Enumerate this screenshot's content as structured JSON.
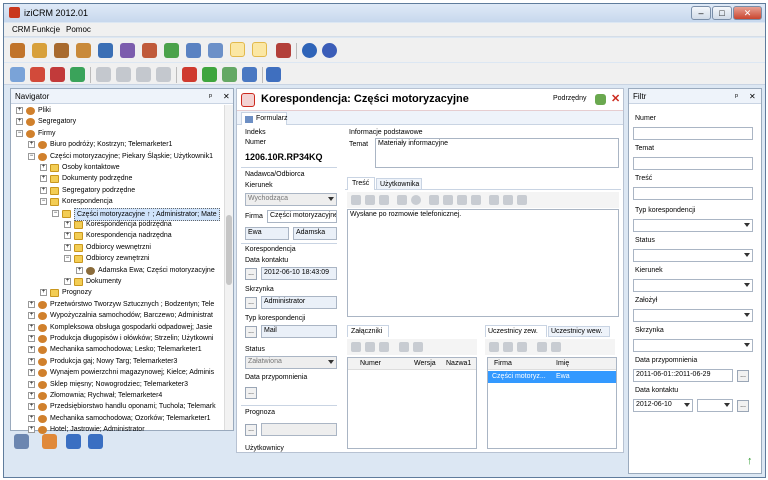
{
  "app": {
    "title": "iziCRM 2012.01"
  },
  "window": {
    "min": "–",
    "max": "□",
    "close": "✕"
  },
  "menu": [
    "CRM",
    "Funkcje",
    "Pomoc"
  ],
  "navigator": {
    "title": "Navigator",
    "pin": "ᵖ",
    "close": "✕",
    "nodes": [
      {
        "label": "Pliki",
        "depth": 0,
        "exp": "+",
        "icon": "gear"
      },
      {
        "label": "Segregatory",
        "depth": 0,
        "exp": "+",
        "icon": "gear"
      },
      {
        "label": "Firmy",
        "depth": 0,
        "exp": "−",
        "icon": "gear"
      },
      {
        "label": "Biuro podróży; Kostrzyn; Telemarketer1",
        "depth": 1,
        "exp": "+",
        "icon": "gear"
      },
      {
        "label": "Części motoryzacyjne; Piekary Śląskie; Użytkownik1",
        "depth": 1,
        "exp": "−",
        "icon": "gear"
      },
      {
        "label": "Osoby kontaktowe",
        "depth": 2,
        "exp": "+",
        "icon": "folder"
      },
      {
        "label": "Dokumenty podrzędne",
        "depth": 2,
        "exp": "+",
        "icon": "folder"
      },
      {
        "label": "Segregatory podrzędne",
        "depth": 2,
        "exp": "+",
        "icon": "folder"
      },
      {
        "label": "Korespondencja",
        "depth": 2,
        "exp": "−",
        "icon": "folder"
      },
      {
        "label": "Części motoryzacyjne ↑ ; Administrator; Mate",
        "depth": 3,
        "exp": "−",
        "icon": "folder",
        "selected": true
      },
      {
        "label": "Korespondencja podrzędna",
        "depth": 4,
        "exp": "+",
        "icon": "folder"
      },
      {
        "label": "Korespondencja nadrzędna",
        "depth": 4,
        "exp": "+",
        "icon": "folder"
      },
      {
        "label": "Odbiorcy wewnętrzni",
        "depth": 4,
        "exp": "+",
        "icon": "folder"
      },
      {
        "label": "Odbiorcy zewnętrzni",
        "depth": 4,
        "exp": "−",
        "icon": "folder"
      },
      {
        "label": "Adamska Ewa; Części motoryzacyjne",
        "depth": 5,
        "exp": "+",
        "icon": "user"
      },
      {
        "label": "Dokumenty",
        "depth": 4,
        "exp": "+",
        "icon": "folder"
      },
      {
        "label": "Prognozy",
        "depth": 2,
        "exp": "+",
        "icon": "folder"
      },
      {
        "label": "Przetwórstwo Tworzyw Sztucznych ; Bodzentyn; Tele",
        "depth": 1,
        "exp": "+",
        "icon": "gear"
      },
      {
        "label": "Wypożyczalnia samochodów; Barczewo; Administrat",
        "depth": 1,
        "exp": "+",
        "icon": "gear"
      },
      {
        "label": "Kompleksowa obsługa gospodarki odpadowej; Jasie",
        "depth": 1,
        "exp": "+",
        "icon": "gear"
      },
      {
        "label": "Produkcja długopisów i ołówków; Strzelin; Użytkowni",
        "depth": 1,
        "exp": "+",
        "icon": "gear"
      },
      {
        "label": "Mechanika samochodowa; Lesko; Telemarketer1",
        "depth": 1,
        "exp": "+",
        "icon": "gear"
      },
      {
        "label": "Produkcja gaj; Nowy Targ; Telemarketer3",
        "depth": 1,
        "exp": "+",
        "icon": "gear"
      },
      {
        "label": "Wynajem powierzchni magazynowej; Kielce; Adminis",
        "depth": 1,
        "exp": "+",
        "icon": "gear"
      },
      {
        "label": "Sklep mięsny; Nowogrodziec; Telemarketer3",
        "depth": 1,
        "exp": "+",
        "icon": "gear"
      },
      {
        "label": "Złomownia; Rychwał; Telemarketer4",
        "depth": 1,
        "exp": "+",
        "icon": "gear"
      },
      {
        "label": "Przedsiębiorstwo handlu oponami; Tuchola; Telemark",
        "depth": 1,
        "exp": "+",
        "icon": "gear"
      },
      {
        "label": "Mechanika samochodowa; Ozorków; Telemarketer1",
        "depth": 1,
        "exp": "+",
        "icon": "gear"
      },
      {
        "label": "Hotel; Jastrowie; Administrator",
        "depth": 1,
        "exp": "+",
        "icon": "gear"
      }
    ]
  },
  "doc": {
    "title": "Korespondencja: Części motoryzacyjne",
    "podrzedny": "Podrzędny",
    "tab": "Formularz",
    "indeks_lbl": "Indeks",
    "numer_lbl": "Numer",
    "numer": "1206.10R.RP34KQ",
    "nadawca_lbl": "Nadawca/Odbiorca",
    "kierunek_lbl": "Kierunek",
    "kierunek": "Wychodząca",
    "firma_lbl": "Firma",
    "firma": "Części motoryzacyjne",
    "imie": "Ewa",
    "nazwisko": "Adamska",
    "koresp_lbl": "Korespondencja",
    "data_kontaktu_lbl": "Data kontaktu",
    "data_kontaktu": "2012-06-10 18:43:09",
    "skrzynka_lbl": "Skrzynka",
    "skrzynka": "Administrator",
    "typ_lbl": "Typ korespondencji",
    "typ": "Mail",
    "status_lbl": "Status",
    "status": "Załatwiona",
    "data_przyp_lbl": "Data przypomnienia",
    "prognoza_lbl": "Prognoza",
    "uzytkownicy_lbl": "Użytkownicy",
    "info_lbl": "Informacje podstawowe",
    "temat_lbl": "Temat",
    "temat": "Materiały informacyjne",
    "tab_tresc": "Treść",
    "tab_uzytk": "Użytkownika",
    "tresc": "Wysłane po rozmowie telefonicznej.",
    "att_tab": "Załączniki",
    "att_cols": [
      "Numer",
      "Wersja",
      "Nazwa1"
    ],
    "uz_tab1": "Uczestnicy zew.",
    "uz_tab2": "Uczestnicy wew.",
    "uz_cols": [
      "Firma",
      "Imię"
    ],
    "uz_row": [
      "Części motoryz...",
      "Ewa"
    ],
    "dots": "..."
  },
  "filter": {
    "title": "Filtr",
    "pin": "ᵖ",
    "close": "✕",
    "numer": "Numer",
    "temat": "Temat",
    "tresc": "Treść",
    "typ": "Typ korespondencji",
    "status": "Status",
    "kierunek": "Kierunek",
    "zalozyl": "Założył",
    "skrzynka": "Skrzynka",
    "data_przyp": "Data przypomnienia",
    "data_przyp_val": "2011-06-01::2011-06-29",
    "data_kontaktu": "Data kontaktu",
    "data_kontaktu_val": "2012-06-10",
    "dots": "..."
  },
  "colors": {
    "accent_red": "#cc2a1e",
    "selection": "#3399ff",
    "chrome": "#dce7f3"
  }
}
